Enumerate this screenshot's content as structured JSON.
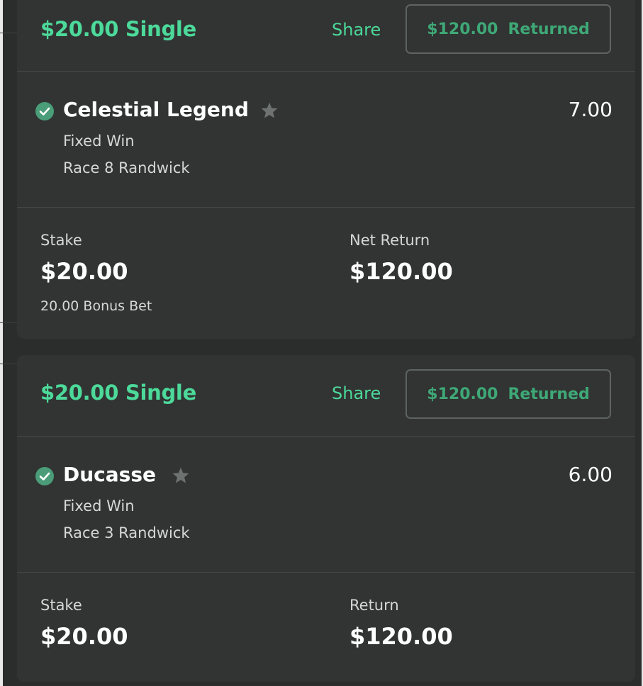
{
  "bets": [
    {
      "title": "$20.00 Single",
      "share_label": "Share",
      "returned": {
        "amount": "$120.00",
        "label": "Returned"
      },
      "selection": {
        "name": "Celestial Legend",
        "odds": "7.00",
        "bet_type": "Fixed Win",
        "race": "Race 8 Randwick",
        "status_icon": "check-circle-icon",
        "favourite_icon": "star-icon"
      },
      "stake_label": "Stake",
      "stake_value": "$20.00",
      "stake_note": "20.00 Bonus Bet",
      "return_label": "Net Return",
      "return_value": "$120.00"
    },
    {
      "title": "$20.00 Single",
      "share_label": "Share",
      "returned": {
        "amount": "$120.00",
        "label": "Returned"
      },
      "selection": {
        "name": "Ducasse",
        "odds": "6.00",
        "bet_type": "Fixed Win",
        "race": "Race 3 Randwick",
        "status_icon": "check-circle-icon",
        "favourite_icon": "star-icon"
      },
      "stake_label": "Stake",
      "stake_value": "$20.00",
      "return_label": "Return",
      "return_value": "$120.00"
    }
  ],
  "colors": {
    "accent": "#4cd99a",
    "returned_text": "#3fa877",
    "check_fill": "#4a9d78",
    "card_bg": "#313433",
    "page_bg": "#2a2d2c",
    "star": "#6e7371"
  }
}
